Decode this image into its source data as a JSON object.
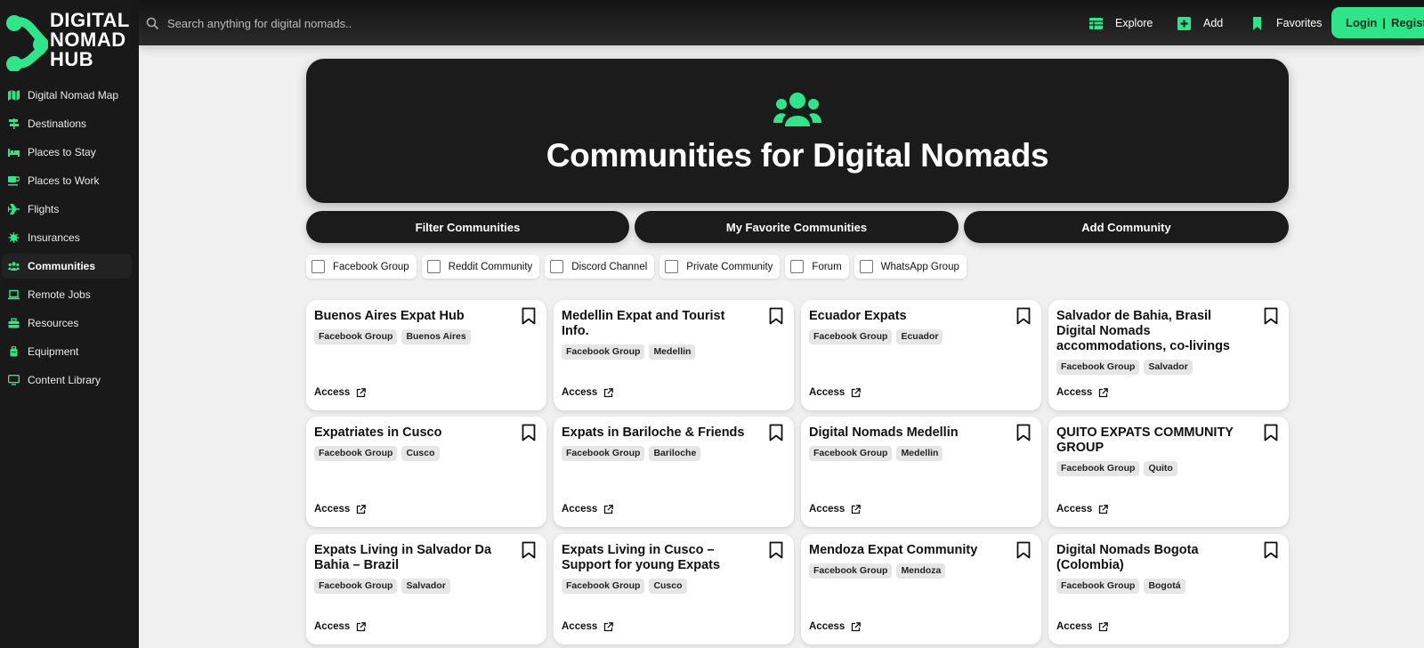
{
  "brand": {
    "line1": "DIGITAL",
    "line2": "NOMAD",
    "line3": "HUB",
    "accent": "#2ee58a"
  },
  "sidebar": {
    "items": [
      {
        "label": "Digital Nomad Map",
        "icon": "map-icon"
      },
      {
        "label": "Destinations",
        "icon": "signpost-icon"
      },
      {
        "label": "Places to Stay",
        "icon": "bed-icon"
      },
      {
        "label": "Places to Work",
        "icon": "coffee-icon"
      },
      {
        "label": "Flights",
        "icon": "plane-icon"
      },
      {
        "label": "Insurances",
        "icon": "virus-icon"
      },
      {
        "label": "Communities",
        "icon": "users-icon",
        "active": true
      },
      {
        "label": "Remote Jobs",
        "icon": "laptop-icon"
      },
      {
        "label": "Resources",
        "icon": "toolbox-icon"
      },
      {
        "label": "Equipment",
        "icon": "suitcase-icon"
      },
      {
        "label": "Content Library",
        "icon": "monitor-icon"
      }
    ]
  },
  "topbar": {
    "search_placeholder": "Search anything for digital nomads..",
    "explore": "Explore",
    "add": "Add",
    "favorites": "Favorites",
    "login": "Login",
    "separator": "|",
    "register": "Register"
  },
  "hero": {
    "title": "Communities for Digital Nomads",
    "icon": "users-icon"
  },
  "actions": {
    "filter": "Filter Communities",
    "favorites": "My Favorite Communities",
    "add": "Add Community"
  },
  "filters": [
    "Facebook Group",
    "Reddit Community",
    "Discord Channel",
    "Private Community",
    "Forum",
    "WhatsApp Group"
  ],
  "cards": [
    {
      "title": "Buenos Aires Expat Hub",
      "tags": [
        "Facebook Group",
        "Buenos Aires"
      ],
      "access": "Access"
    },
    {
      "title": "Medellin Expat and Tourist Info.",
      "tags": [
        "Facebook Group",
        "Medellin"
      ],
      "access": "Access"
    },
    {
      "title": "Ecuador Expats",
      "tags": [
        "Facebook Group",
        "Ecuador"
      ],
      "access": "Access"
    },
    {
      "title": "Salvador de Bahia, Brasil Digital Nomads accommodations, co-livings",
      "tags": [
        "Facebook Group",
        "Salvador"
      ],
      "access": "Access"
    },
    {
      "title": "Expatriates in Cusco",
      "tags": [
        "Facebook Group",
        "Cusco"
      ],
      "access": "Access"
    },
    {
      "title": "Expats in Bariloche & Friends",
      "tags": [
        "Facebook Group",
        "Bariloche"
      ],
      "access": "Access"
    },
    {
      "title": "Digital Nomads Medellin",
      "tags": [
        "Facebook Group",
        "Medellin"
      ],
      "access": "Access"
    },
    {
      "title": "QUITO EXPATS COMMUNITY GROUP",
      "tags": [
        "Facebook Group",
        "Quito"
      ],
      "access": "Access"
    },
    {
      "title": "Expats Living in Salvador Da Bahia – Brazil",
      "tags": [
        "Facebook Group",
        "Salvador"
      ],
      "access": "Access"
    },
    {
      "title": "Expats Living in Cusco – Support for young Expats",
      "tags": [
        "Facebook Group",
        "Cusco"
      ],
      "access": "Access"
    },
    {
      "title": "Mendoza Expat Community",
      "tags": [
        "Facebook Group",
        "Mendoza"
      ],
      "access": "Access"
    },
    {
      "title": "Digital Nomads Bogota (Colombia)",
      "tags": [
        "Facebook Group",
        "Bogotá"
      ],
      "access": "Access"
    }
  ]
}
